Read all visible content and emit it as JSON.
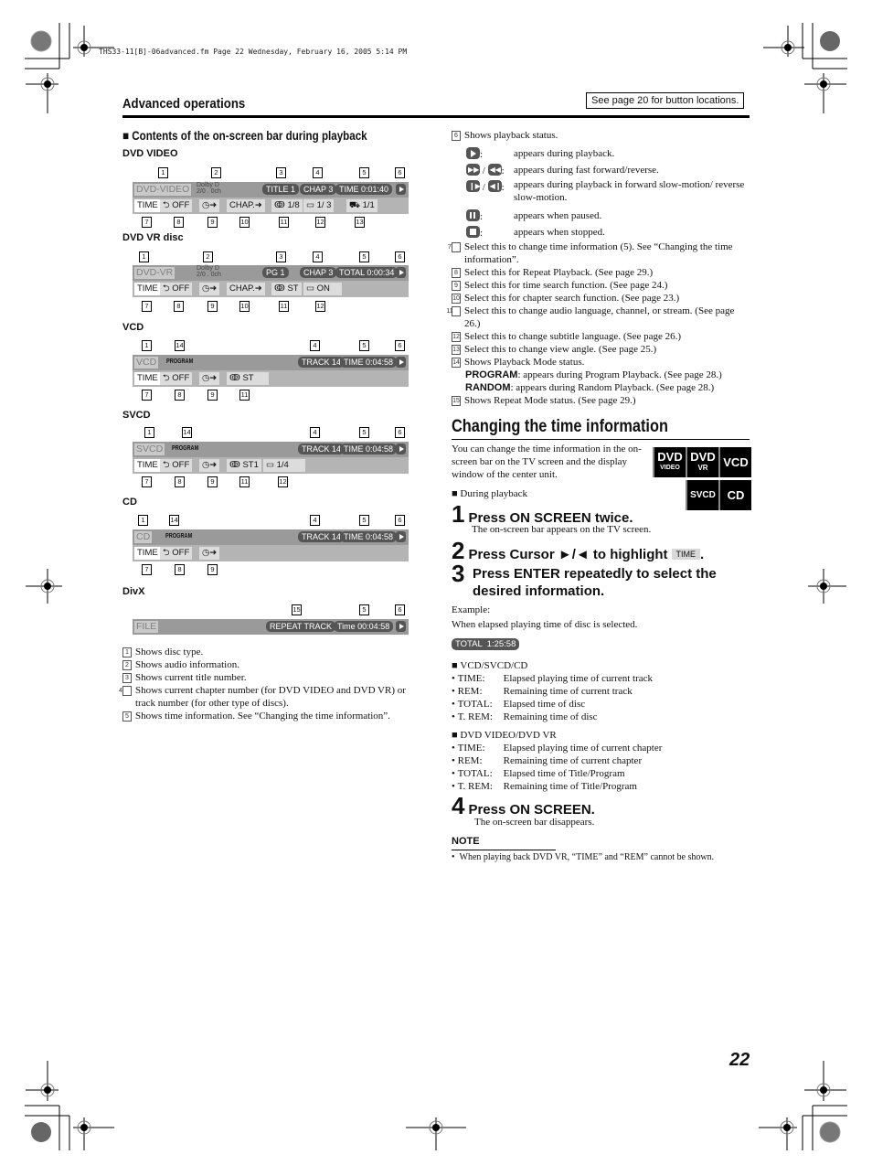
{
  "print_header": "THS33-11[B]-06advanced.fm  Page 22  Wednesday, February 16, 2005  5:14 PM",
  "section_title": "Advanced operations",
  "see_page_box": "See page 20 for button locations.",
  "left": {
    "heading": "Contents of the on-screen bar during playback",
    "bars": {
      "dvd_video": {
        "label": "DVD VIDEO",
        "disc": "DVD-VIDEO",
        "audio1": "Dolby D",
        "audio2": "2/0 . 0ch",
        "title": "TITLE  1",
        "chap": "CHAP  3",
        "time": "TIME   0:01:40",
        "cells": [
          "TIME",
          "⮌ OFF",
          "◷➜",
          "CHAP.➜",
          "ↂ 1/8",
          "▭ 1/  3",
          "⛟ 1/1"
        ],
        "callouts_top": [
          "1",
          "2",
          "3",
          "4",
          "5",
          "6"
        ],
        "callouts_bottom": [
          "7",
          "8",
          "9",
          "10",
          "11",
          "12",
          "13"
        ]
      },
      "dvd_vr": {
        "label": "DVD VR disc",
        "disc": "DVD-VR",
        "audio1": "Dolby D",
        "audio2": "2/0 . 0ch",
        "title": "PG      1",
        "chap": "CHAP  3",
        "time": "TOTAL  0:00:34",
        "cells": [
          "TIME",
          "⮌ OFF",
          "◷➜",
          "CHAP.➜",
          "ↂ ST",
          "▭  ON"
        ],
        "callouts_top": [
          "1",
          "2",
          "3",
          "4",
          "5",
          "6"
        ],
        "callouts_bottom": [
          "7",
          "8",
          "9",
          "10",
          "11",
          "12"
        ]
      },
      "vcd": {
        "label": "VCD",
        "disc": "VCD",
        "mode": "PROGRAM",
        "track": "TRACK 14",
        "time": "TIME   0:04:58",
        "cells": [
          "TIME",
          "⮌ OFF",
          "◷➜",
          "ↂ ST"
        ],
        "callouts_top": [
          "1",
          "14",
          "4",
          "5",
          "6"
        ],
        "callouts_bottom": [
          "7",
          "8",
          "9",
          "11"
        ]
      },
      "svcd": {
        "label": "SVCD",
        "disc": "SVCD",
        "mode": "PROGRAM",
        "track": "TRACK 14",
        "time": "TIME   0:04:58",
        "cells": [
          "TIME",
          "⮌ OFF",
          "◷➜",
          "ↂ ST1",
          "▭   1/4"
        ],
        "callouts_top": [
          "1",
          "14",
          "4",
          "5",
          "6"
        ],
        "callouts_bottom": [
          "7",
          "8",
          "9",
          "11",
          "12"
        ]
      },
      "cd": {
        "label": "CD",
        "disc": "CD",
        "mode": "PROGRAM",
        "track": "TRACK 14",
        "time": "TIME   0:04:58",
        "cells": [
          "TIME",
          "⮌ OFF",
          "◷➜"
        ],
        "callouts_top": [
          "1",
          "14",
          "4",
          "5",
          "6"
        ],
        "callouts_bottom": [
          "7",
          "8",
          "9"
        ]
      },
      "divx": {
        "label": "DivX",
        "disc": "FILE",
        "repeat": "REPEAT TRACK",
        "time": "Time   00:04:58",
        "callouts_top": [
          "15",
          "5",
          "6"
        ]
      }
    },
    "descriptions": [
      {
        "n": "1",
        "text": "Shows disc type."
      },
      {
        "n": "2",
        "text": "Shows audio information."
      },
      {
        "n": "3",
        "text": "Shows current title number."
      },
      {
        "n": "4",
        "text": "Shows current chapter number (for DVD VIDEO and DVD VR) or track number (for other type of discs)."
      },
      {
        "n": "5",
        "text": "Shows time information. See “Changing the time information”."
      }
    ]
  },
  "right": {
    "desc6": {
      "n": "6",
      "text": "Shows playback status."
    },
    "status_items": [
      {
        "icons": "play",
        "text": "appears during playback."
      },
      {
        "icons": "fast-forward / fast-reverse",
        "text": "appears during fast forward/reverse."
      },
      {
        "icons": "slow-forward / slow-reverse",
        "text": "appears during playback in forward slow-motion/ reverse slow-motion."
      },
      {
        "icons": "pause",
        "text": "appears when paused."
      },
      {
        "icons": "stop",
        "text": "appears when stopped."
      }
    ],
    "descriptions": [
      {
        "n": "7",
        "text": "Select this to change time information (5). See “Changing the time information”."
      },
      {
        "n": "8",
        "text": "Select this for Repeat Playback. (See page 29.)"
      },
      {
        "n": "9",
        "text": "Select this for time search function. (See page 24.)"
      },
      {
        "n": "10",
        "text": "Select this for chapter search function. (See page 23.)"
      },
      {
        "n": "11",
        "text": "Select this to change audio language, channel, or stream. (See page 26.)"
      },
      {
        "n": "12",
        "text": "Select this to change subtitle language. (See page 26.)"
      },
      {
        "n": "13",
        "text": "Select this to change view angle. (See page 25.)"
      },
      {
        "n": "14",
        "text": "Shows Playback Mode status."
      }
    ],
    "mode_program": {
      "term": "PROGRAM",
      "text": ": appears during Program Playback. (See page 28.)"
    },
    "mode_random": {
      "term": "RANDOM",
      "text": ": appears during Random Playback. (See page 28.)"
    },
    "desc15": {
      "n": "15",
      "text": "Shows Repeat Mode status. (See page 29.)"
    },
    "changing": {
      "title": "Changing the time information",
      "intro": "You can change the time information in the on-screen bar on the TV screen and the display window of the center unit.",
      "badges": [
        {
          "main": "DVD",
          "sub": "VIDEO"
        },
        {
          "main": "DVD",
          "sub": "VR"
        },
        {
          "main": "VCD",
          "sub": ""
        },
        {
          "main": "SVCD",
          "sub": ""
        },
        {
          "main": "CD",
          "sub": ""
        }
      ],
      "during": "During playback",
      "steps": [
        {
          "n": "1",
          "text": "Press ON SCREEN twice.",
          "sub": "The on-screen bar appears on the TV screen."
        },
        {
          "n": "2",
          "text": "Press Cursor ►/◄ to highlight",
          "chip": "TIME",
          "tail": "."
        },
        {
          "n": "3",
          "text": "Press ENTER repeatedly to select the desired information."
        },
        {
          "n": "4",
          "text": "Press ON SCREEN.",
          "sub": "The on-screen bar disappears."
        }
      ],
      "example_label": "Example:",
      "example_text": "When elapsed playing time of disc is selected.",
      "example_pill": "TOTAL  1:25:58",
      "group_vcd": {
        "title": "VCD/SVCD/CD",
        "items": [
          {
            "k": "TIME:",
            "v": "Elapsed playing time of current track"
          },
          {
            "k": "REM:",
            "v": "Remaining time of current track"
          },
          {
            "k": "TOTAL:",
            "v": "Elapsed time of disc"
          },
          {
            "k": "T. REM:",
            "v": "Remaining time of disc"
          }
        ]
      },
      "group_dvd": {
        "title": "DVD VIDEO/DVD VR",
        "items": [
          {
            "k": "TIME:",
            "v": "Elapsed playing time of current chapter"
          },
          {
            "k": "REM:",
            "v": "Remaining time of current chapter"
          },
          {
            "k": "TOTAL:",
            "v": "Elapsed time of Title/Program"
          },
          {
            "k": "T. REM:",
            "v": "Remaining time of Title/Program"
          }
        ]
      },
      "note_title": "NOTE",
      "note_text": "When playing back DVD VR, “TIME” and “REM” cannot be shown."
    }
  },
  "page_number": "22"
}
